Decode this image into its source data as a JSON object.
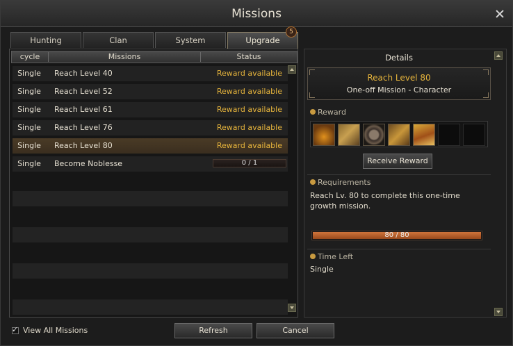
{
  "window": {
    "title": "Missions"
  },
  "tabs": [
    {
      "label": "Hunting"
    },
    {
      "label": "Clan"
    },
    {
      "label": "System"
    },
    {
      "label": "Upgrade",
      "badge": "5",
      "active": true
    }
  ],
  "table": {
    "columns": [
      "cycle",
      "Missions",
      "Status"
    ],
    "rows": [
      {
        "cycle": "Single",
        "mission": "Reach Level 40",
        "status": "Reward available"
      },
      {
        "cycle": "Single",
        "mission": "Reach Level 52",
        "status": "Reward available"
      },
      {
        "cycle": "Single",
        "mission": "Reach Level 61",
        "status": "Reward available"
      },
      {
        "cycle": "Single",
        "mission": "Reach Level 76",
        "status": "Reward available"
      },
      {
        "cycle": "Single",
        "mission": "Reach Level 80",
        "status": "Reward available",
        "selected": true
      },
      {
        "cycle": "Single",
        "mission": "Become Noblesse",
        "status": "",
        "progress_text": "0 / 1",
        "progress": 0
      }
    ]
  },
  "details": {
    "title": "Details",
    "mission_name": "Reach Level 80",
    "mission_type": "One-off Mission  -  Character",
    "reward_label": "Reward",
    "reward_items": [
      "potion-icon",
      "tome-icon",
      "coin-icon",
      "book-icon",
      "chest-icon"
    ],
    "receive_button": "Receive Reward",
    "requirements_label": "Requirements",
    "requirements_text": "Reach Lv. 80 to complete this one-time growth mission.",
    "progress_text": "80 / 80",
    "progress": 1.0,
    "time_left_label": "Time Left",
    "time_left_value": "Single"
  },
  "footer": {
    "view_all_label": "View All Missions",
    "view_all_checked": true,
    "refresh_button": "Refresh",
    "cancel_button": "Cancel"
  },
  "colors": {
    "reward_available": "#e6b43c",
    "progress_fill": "#c8642a",
    "selected_row": "#4a3b26"
  }
}
